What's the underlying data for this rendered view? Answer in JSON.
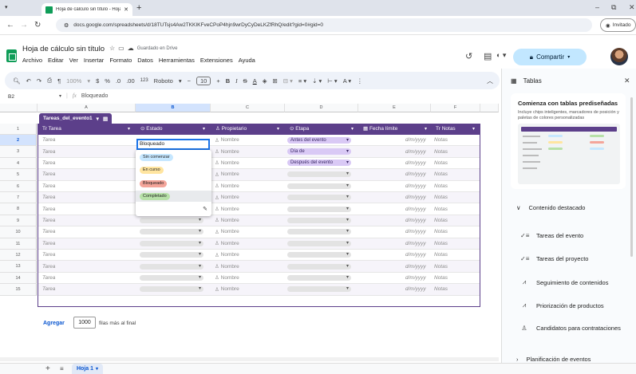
{
  "browser": {
    "tab_title": "Hoja de cálculo sin título - Hoja",
    "url": "docs.google.com/spreadsheets/d/18TUTsjs4Aw2TKKIKFveCPoP4hjn9wrDyCyDeLKZfRhQ/edit?gid=0#gid=0",
    "incognito_label": "Invitado"
  },
  "doc": {
    "title": "Hoja de cálculo sin título",
    "saved_status": "Guardado en Drive",
    "menus": [
      "Archivo",
      "Editar",
      "Ver",
      "Insertar",
      "Formato",
      "Datos",
      "Herramientas",
      "Extensiones",
      "Ayuda"
    ],
    "share_label": "Compartir"
  },
  "toolbar": {
    "zoom": "100%",
    "currency": "$",
    "percent": "%",
    "dec_less": ".0",
    "dec_more": ".00",
    "num_format": "123",
    "font": "Roboto",
    "font_size": "10"
  },
  "formula_bar": {
    "cell_ref": "B2",
    "fx_label": "fx",
    "content": "Bloqueado"
  },
  "grid": {
    "col_headers": [
      "A",
      "B",
      "C",
      "D",
      "E",
      "F"
    ],
    "rows": [
      "1",
      "2",
      "3",
      "4",
      "5",
      "6",
      "7",
      "8",
      "9",
      "10",
      "11",
      "12",
      "13",
      "14",
      "15"
    ],
    "table_name": "Tareas_del_evento1",
    "headers": {
      "tarea": "Tr  Tarea",
      "estado": "Estado",
      "propietario": "Propietario",
      "etapa": "Etapa",
      "fecha": "Fecha límite",
      "notas": "Tr  Notas"
    },
    "placeholders": {
      "tarea": "Tarea",
      "nombre": "Nombre",
      "fecha": "d/m/yyyy",
      "notas": "Notas"
    },
    "etapa_values": [
      "Antes del evento",
      "Día de",
      "Después del evento"
    ],
    "editing_value": "Bloqueado",
    "status_options": [
      "Sin comenzar",
      "En curso",
      "Bloqueado",
      "Completado"
    ],
    "add_label": "Agregar",
    "add_count": "1000",
    "add_suffix": "filas más al final"
  },
  "sheet_tab": "Hoja 1",
  "side_panel": {
    "title": "Tablas",
    "card_title": "Comienza con tablas prediseñadas",
    "card_desc": "Incluye chips inteligentes, marcadores de posición y paletas de colores personalizadas",
    "featured": "Contenido destacado",
    "items": [
      {
        "label": "Tareas del evento",
        "icon": "checklist-icon"
      },
      {
        "label": "Tareas del proyecto",
        "icon": "checklist-icon"
      },
      {
        "label": "Seguimiento de contenidos",
        "icon": "trend-icon"
      },
      {
        "label": "Priorización de productos",
        "icon": "trend-icon"
      },
      {
        "label": "Candidatos para contrataciones",
        "icon": "person-icon"
      }
    ],
    "next_section": "Planificación de eventos"
  },
  "colors": {
    "table_header": "#5c3f8a",
    "share_button": "#c2e7ff",
    "status_sin_comenzar": "#c6e7ff",
    "status_en_curso": "#ffe5a0",
    "status_bloqueado": "#f4a59a",
    "status_completado": "#b7e1a8",
    "etapa_chip": "#d9c9f5"
  }
}
